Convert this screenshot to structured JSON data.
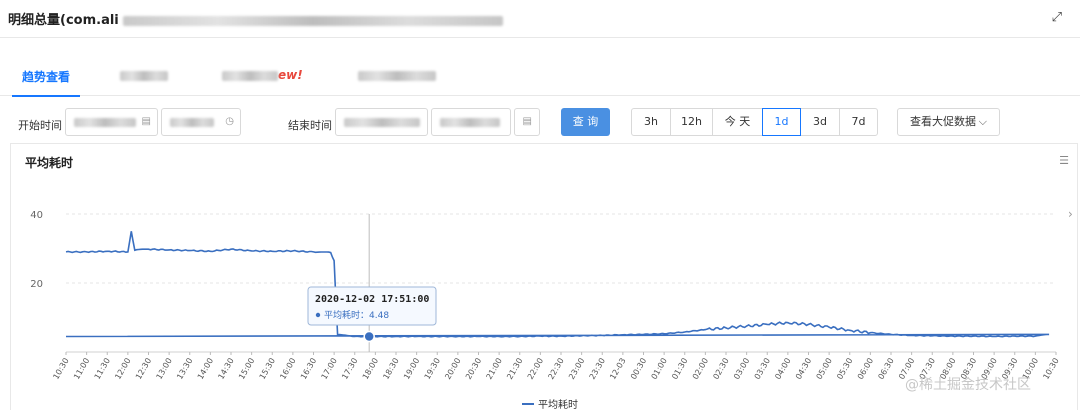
{
  "window": {
    "title": "明细总量(com.ali",
    "expand_icon": "expand-arrows-icon"
  },
  "tabs": [
    {
      "label": "趋势查看",
      "active": true
    },
    {
      "label": "",
      "suffix": ""
    },
    {
      "label": "",
      "suffix": "ew!"
    },
    {
      "label": "",
      "suffix": ""
    }
  ],
  "filters": {
    "start_label": "开始时间",
    "end_label": "结束时间",
    "query_label": "查 询",
    "ranges": [
      "3h",
      "12h",
      "今 天",
      "1d",
      "3d",
      "7d"
    ],
    "selected_range": "1d",
    "promo_label": "查看大促数据"
  },
  "chart_panel": {
    "title": "平均耗时",
    "menu_icon": "list-menu-icon",
    "legend_icon": "chevron-right-icon"
  },
  "watermark": "@稀土掘金技术社区",
  "colors": {
    "accent": "#1677ff",
    "query_button": "#4a90e2",
    "series": "#3a6fc0"
  },
  "chart_data": {
    "type": "line",
    "title": "平均耗时",
    "ylim": [
      0,
      40
    ],
    "y_ticks": [
      20,
      40
    ],
    "x_labels": [
      "10:30",
      "11:00",
      "11:30",
      "12:00",
      "12:30",
      "13:00",
      "13:30",
      "14:00",
      "14:30",
      "15:00",
      "15:30",
      "16:00",
      "16:30",
      "17:00",
      "17:30",
      "18:00",
      "18:30",
      "19:00",
      "19:30",
      "20:00",
      "20:30",
      "21:00",
      "21:30",
      "22:00",
      "22:30",
      "23:00",
      "23:30",
      "12-03",
      "00:30",
      "01:00",
      "01:30",
      "02:00",
      "02:30",
      "03:00",
      "03:30",
      "04:00",
      "04:30",
      "05:00",
      "05:30",
      "06:00",
      "06:30",
      "07:00",
      "07:30",
      "08:00",
      "08:30",
      "09:00",
      "09:30",
      "10:00",
      "10:30"
    ],
    "grid": "horizontal dashed",
    "legend_position": "bottom",
    "series": [
      {
        "name": "平均耗时",
        "points": [
          [
            "10:30",
            29.0
          ],
          [
            "11:00",
            29.0
          ],
          [
            "11:30",
            29.2
          ],
          [
            "12:00",
            29.0
          ],
          [
            "12:05",
            35.0
          ],
          [
            "12:10",
            29.5
          ],
          [
            "12:30",
            29.8
          ],
          [
            "13:00",
            29.6
          ],
          [
            "13:30",
            29.4
          ],
          [
            "14:00",
            29.2
          ],
          [
            "14:30",
            29.8
          ],
          [
            "15:00",
            29.3
          ],
          [
            "15:30",
            29.2
          ],
          [
            "16:00",
            29.3
          ],
          [
            "16:30",
            29.0
          ],
          [
            "16:55",
            28.8
          ],
          [
            "17:00",
            26.5
          ],
          [
            "17:05",
            5.0
          ],
          [
            "17:30",
            4.5
          ],
          [
            "17:51",
            4.48
          ],
          [
            "18:30",
            4.5
          ],
          [
            "19:00",
            4.5
          ],
          [
            "19:30",
            4.5
          ],
          [
            "20:00",
            4.5
          ],
          [
            "20:30",
            4.5
          ],
          [
            "21:00",
            4.5
          ],
          [
            "21:30",
            4.5
          ],
          [
            "22:00",
            4.6
          ],
          [
            "22:30",
            4.6
          ],
          [
            "23:00",
            4.7
          ],
          [
            "23:30",
            4.8
          ],
          [
            "12-03",
            5.0
          ],
          [
            "00:30",
            5.1
          ],
          [
            "01:00",
            5.3
          ],
          [
            "01:30",
            5.8
          ],
          [
            "02:00",
            6.5
          ],
          [
            "02:30",
            7.0
          ],
          [
            "03:00",
            7.5
          ],
          [
            "03:30",
            8.0
          ],
          [
            "04:00",
            8.5
          ],
          [
            "04:30",
            8.0
          ],
          [
            "05:00",
            7.2
          ],
          [
            "05:30",
            6.3
          ],
          [
            "06:00",
            5.6
          ],
          [
            "06:30",
            5.1
          ],
          [
            "07:00",
            4.8
          ],
          [
            "07:30",
            4.7
          ],
          [
            "08:00",
            4.6
          ],
          [
            "08:30",
            4.6
          ],
          [
            "09:00",
            4.5
          ],
          [
            "09:30",
            4.6
          ],
          [
            "10:00",
            4.6
          ],
          [
            "10:20",
            5.1
          ],
          [
            "10:30",
            4.5
          ]
        ]
      }
    ],
    "tooltip": {
      "time": "2020-12-02 17:51:00",
      "series_name": "平均耗时",
      "value": "4.48"
    },
    "legend": [
      "平均耗时"
    ]
  }
}
